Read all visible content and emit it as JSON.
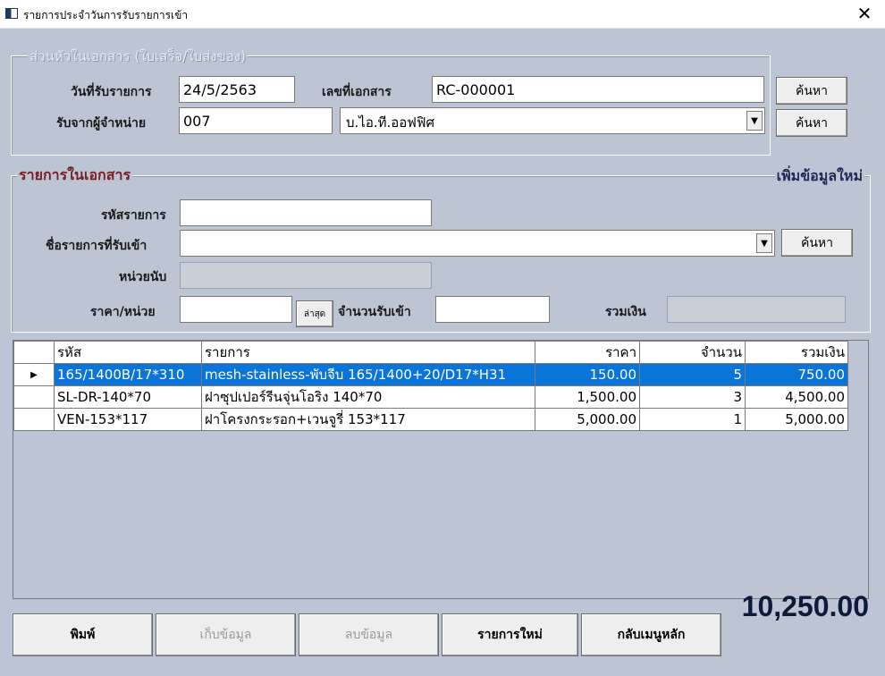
{
  "window": {
    "title": "รายการประจำวันการรับรายการเข้า",
    "close_glyph": "✕"
  },
  "header_group": {
    "legend": "ส่วนหัวในเอกสาร (ใบเสร็จ/ใบส่งของ)",
    "receive_date_label": "วันที่รับรายการ",
    "receive_date_value": "24/5/2563",
    "doc_no_label": "เลขที่เอกสาร",
    "doc_no_value": "RC-000001",
    "search_doc_label": "ค้นหา",
    "supplier_label": "รับจากผู้จำหน่าย",
    "supplier_code_value": "007",
    "supplier_name_value": "บ.ไอ.ที.ออฟฟิศ",
    "search_supplier_label": "ค้นหา"
  },
  "items_group": {
    "legend": "รายการในเอกสาร",
    "add_new_label": "เพิ่มข้อมูลใหม่",
    "item_code_label": "รหัสรายการ",
    "item_code_value": "",
    "item_name_label": "ชื่อรายการที่รับเข้า",
    "item_name_value": "",
    "search_item_label": "ค้นหา",
    "unit_label": "หน่วยนับ",
    "unit_value": "",
    "price_label": "ราคา/หน่วย",
    "price_value": "",
    "latest_label": "ล่าสุด",
    "qty_label": "จำนวนรับเข้า",
    "qty_value": "",
    "line_total_label": "รวมเงิน",
    "line_total_value": ""
  },
  "grid": {
    "columns": [
      "รหัส",
      "รายการ",
      "ราคา",
      "จำนวน",
      "รวมเงิน"
    ],
    "rows": [
      {
        "code": "165/1400B/17*310",
        "name": "mesh-stainless-พับจีบ 165/1400+20/D17*H31",
        "price": "150.00",
        "qty": "5",
        "total": "750.00",
        "selected": true
      },
      {
        "code": "SL-DR-140*70",
        "name": "ฝาซุปเปอร์รีนจุ่นโอริง 140*70",
        "price": "1,500.00",
        "qty": "3",
        "total": "4,500.00",
        "selected": false
      },
      {
        "code": "VEN-153*117",
        "name": "ฝาโครงกระรอก+เวนจูรี่ 153*117",
        "price": "5,000.00",
        "qty": "1",
        "total": "5,000.00",
        "selected": false
      }
    ],
    "row_indicator_glyph": "▶"
  },
  "footer": {
    "print_label": "พิมพ์",
    "save_label": "เก็บข้อมูล",
    "delete_label": "ลบข้อมูล",
    "new_label": "รายการใหม่",
    "back_label": "กลับเมนูหลัก",
    "grand_total": "10,250.00"
  },
  "colors": {
    "form_background": "#bdc4d3",
    "selection": "#0a74d9",
    "legend_red": "#7a1e24",
    "total_navy": "#0d1b3a"
  },
  "icons": {
    "app": "app-window-icon",
    "dropdown": "chevron-down-icon"
  }
}
